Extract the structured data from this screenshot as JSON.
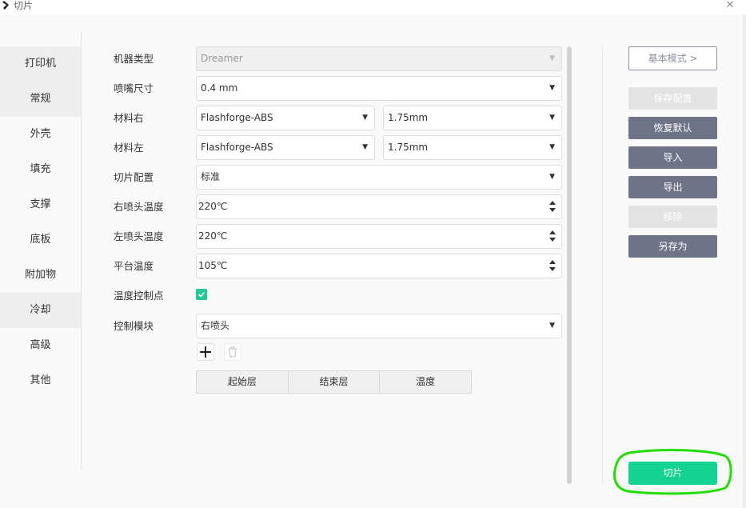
{
  "window": {
    "title": "切片",
    "close": "✕"
  },
  "sidebar": {
    "items": [
      {
        "label": "打印机"
      },
      {
        "label": "常规"
      },
      {
        "label": "外壳"
      },
      {
        "label": "填充"
      },
      {
        "label": "支撑"
      },
      {
        "label": "底板"
      },
      {
        "label": "附加物"
      },
      {
        "label": "冷却"
      },
      {
        "label": "高级"
      },
      {
        "label": "其他"
      }
    ]
  },
  "form": {
    "machine_type": {
      "label": "机器类型",
      "value": "Dreamer"
    },
    "nozzle_size": {
      "label": "喷嘴尺寸",
      "value": "0.4 mm"
    },
    "material_right": {
      "label": "材料右",
      "value": "Flashforge-ABS",
      "diameter": "1.75mm"
    },
    "material_left": {
      "label": "材料左",
      "value": "Flashforge-ABS",
      "diameter": "1.75mm"
    },
    "slice_profile": {
      "label": "切片配置",
      "value": "标准"
    },
    "right_nozzle_temp": {
      "label": "右喷头温度",
      "value": "220℃"
    },
    "left_nozzle_temp": {
      "label": "左喷头温度",
      "value": "220℃"
    },
    "platform_temp": {
      "label": "平台温度",
      "value": "105℃"
    },
    "temp_control_point": {
      "label": "温度控制点",
      "checked": true
    },
    "control_module": {
      "label": "控制模块",
      "value": "右喷头"
    },
    "table": {
      "columns": [
        "起始层",
        "结束层",
        "温度"
      ]
    }
  },
  "actions": {
    "basic_mode": "基本模式 >",
    "save_config": "保存配置",
    "restore_default": "恢复默认",
    "import": "导入",
    "export": "导出",
    "remove": "移除",
    "save_as": "另存为",
    "slice": "切片"
  },
  "colors": {
    "accent_green": "#14d392",
    "checkbox_green": "#20c997",
    "button_dark": "#6e7387",
    "highlight_ring": "#22dd00"
  }
}
